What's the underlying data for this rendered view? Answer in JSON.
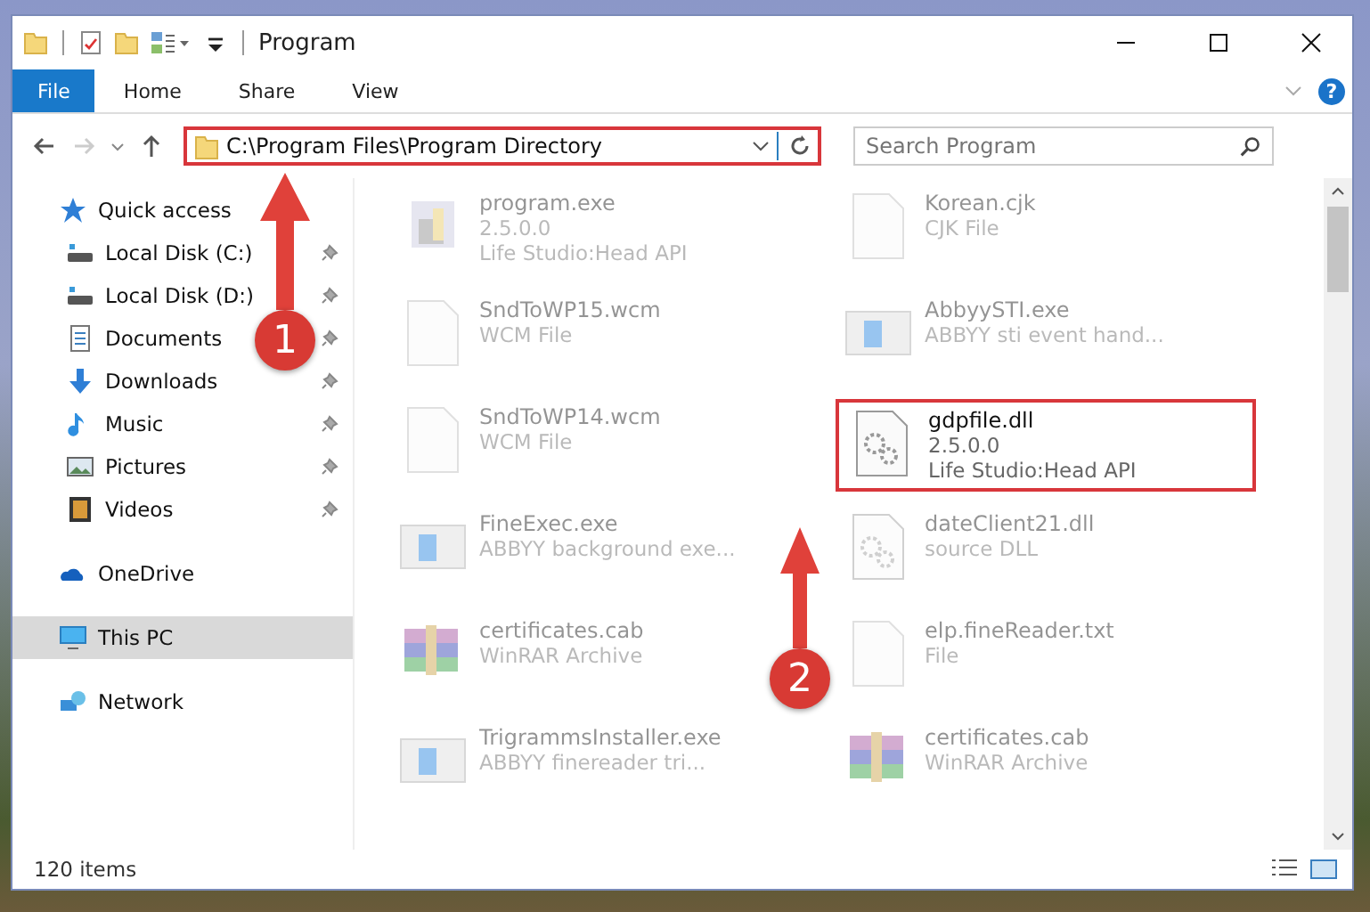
{
  "window": {
    "title": "Program"
  },
  "help": {
    "glyph": "?"
  },
  "ribbon_tabs": [
    {
      "label": "File",
      "selected": true
    },
    {
      "label": "Home",
      "selected": false
    },
    {
      "label": "Share",
      "selected": false
    },
    {
      "label": "View",
      "selected": false
    }
  ],
  "address_bar": {
    "path": "C:\\Program Files\\Program Directory",
    "highlighted": true
  },
  "search": {
    "placeholder": "Search Program"
  },
  "sidebar": {
    "items": [
      {
        "label": "Quick access",
        "selected": false,
        "children": [
          {
            "label": "Local Disk (C:)",
            "pinned": true,
            "selected": false
          },
          {
            "label": "Local Disk (D:)",
            "pinned": true,
            "selected": false
          },
          {
            "label": "Documents",
            "pinned": true,
            "selected": false
          },
          {
            "label": "Downloads",
            "pinned": true,
            "selected": false
          },
          {
            "label": "Music",
            "pinned": true,
            "selected": false
          },
          {
            "label": "Pictures",
            "pinned": true,
            "selected": false
          },
          {
            "label": "Videos",
            "pinned": true,
            "selected": false
          }
        ]
      },
      {
        "label": "OneDrive",
        "selected": false
      },
      {
        "label": "This PC",
        "selected": true
      },
      {
        "label": "Network",
        "selected": false
      }
    ]
  },
  "files": [
    {
      "kind": "app",
      "name": "program.exe",
      "lines": [
        "2.5.0.0",
        "Life Studio:Head API"
      ],
      "highlighted": false
    },
    {
      "kind": "blank",
      "name": "Korean.cjk",
      "lines": [
        "CJK File"
      ],
      "highlighted": false
    },
    {
      "kind": "blank",
      "name": "SndToWP15.wcm",
      "lines": [
        "WCM File"
      ],
      "highlighted": false
    },
    {
      "kind": "window",
      "name": "AbbyySTI.exe",
      "lines": [
        "ABBYY sti event hand..."
      ],
      "highlighted": false
    },
    {
      "kind": "blank",
      "name": "SndToWP14.wcm",
      "lines": [
        "WCM File"
      ],
      "highlighted": false
    },
    {
      "kind": "gear",
      "name": "gdpfile.dll",
      "lines": [
        "2.5.0.0",
        "Life Studio:Head API"
      ],
      "highlighted": true
    },
    {
      "kind": "window",
      "name": "FineExec.exe",
      "lines": [
        "ABBYY background exe..."
      ],
      "highlighted": false
    },
    {
      "kind": "gear",
      "name": "dateClient21.dll",
      "lines": [
        "source DLL"
      ],
      "highlighted": false
    },
    {
      "kind": "archive",
      "name": "certificates.cab",
      "lines": [
        "WinRAR Archive"
      ],
      "highlighted": false
    },
    {
      "kind": "blank",
      "name": "elp.fineReader.txt",
      "lines": [
        "File"
      ],
      "highlighted": false
    },
    {
      "kind": "window",
      "name": "TrigrammsInstaller.exe",
      "lines": [
        "ABBYY finereader tri..."
      ],
      "highlighted": false
    },
    {
      "kind": "archive",
      "name": "certificates.cab",
      "lines": [
        "WinRAR Archive"
      ],
      "highlighted": false
    }
  ],
  "status_bar": {
    "item_count": "120 items"
  },
  "annotations": [
    {
      "number": "1"
    },
    {
      "number": "2"
    }
  ]
}
